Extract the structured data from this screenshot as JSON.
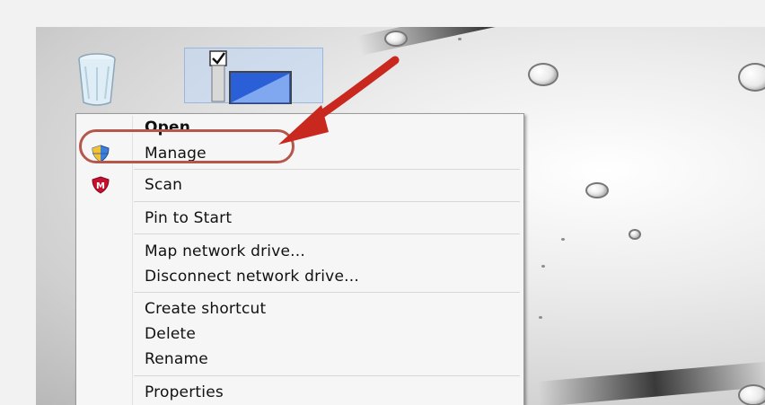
{
  "desktop": {
    "icons": [
      {
        "name": "recycle-bin-icon"
      },
      {
        "name": "computer-icon",
        "selected": true
      }
    ]
  },
  "context_menu": {
    "groups": [
      [
        {
          "label": "Open",
          "bold": true,
          "icon": ""
        },
        {
          "label": "Manage",
          "bold": false,
          "icon": "uac-shield-icon"
        }
      ],
      [
        {
          "label": "Scan",
          "bold": false,
          "icon": "mcafee-icon"
        }
      ],
      [
        {
          "label": "Pin to Start",
          "bold": false,
          "icon": ""
        }
      ],
      [
        {
          "label": "Map network drive...",
          "bold": false,
          "icon": ""
        },
        {
          "label": "Disconnect network drive...",
          "bold": false,
          "icon": ""
        }
      ],
      [
        {
          "label": "Create shortcut",
          "bold": false,
          "icon": ""
        },
        {
          "label": "Delete",
          "bold": false,
          "icon": ""
        },
        {
          "label": "Rename",
          "bold": false,
          "icon": ""
        }
      ],
      [
        {
          "label": "Properties",
          "bold": false,
          "icon": ""
        }
      ]
    ]
  },
  "annotation": {
    "highlight_target": "Manage",
    "arrow_color": "#c8281e",
    "highlight_color": "#b5574a"
  }
}
